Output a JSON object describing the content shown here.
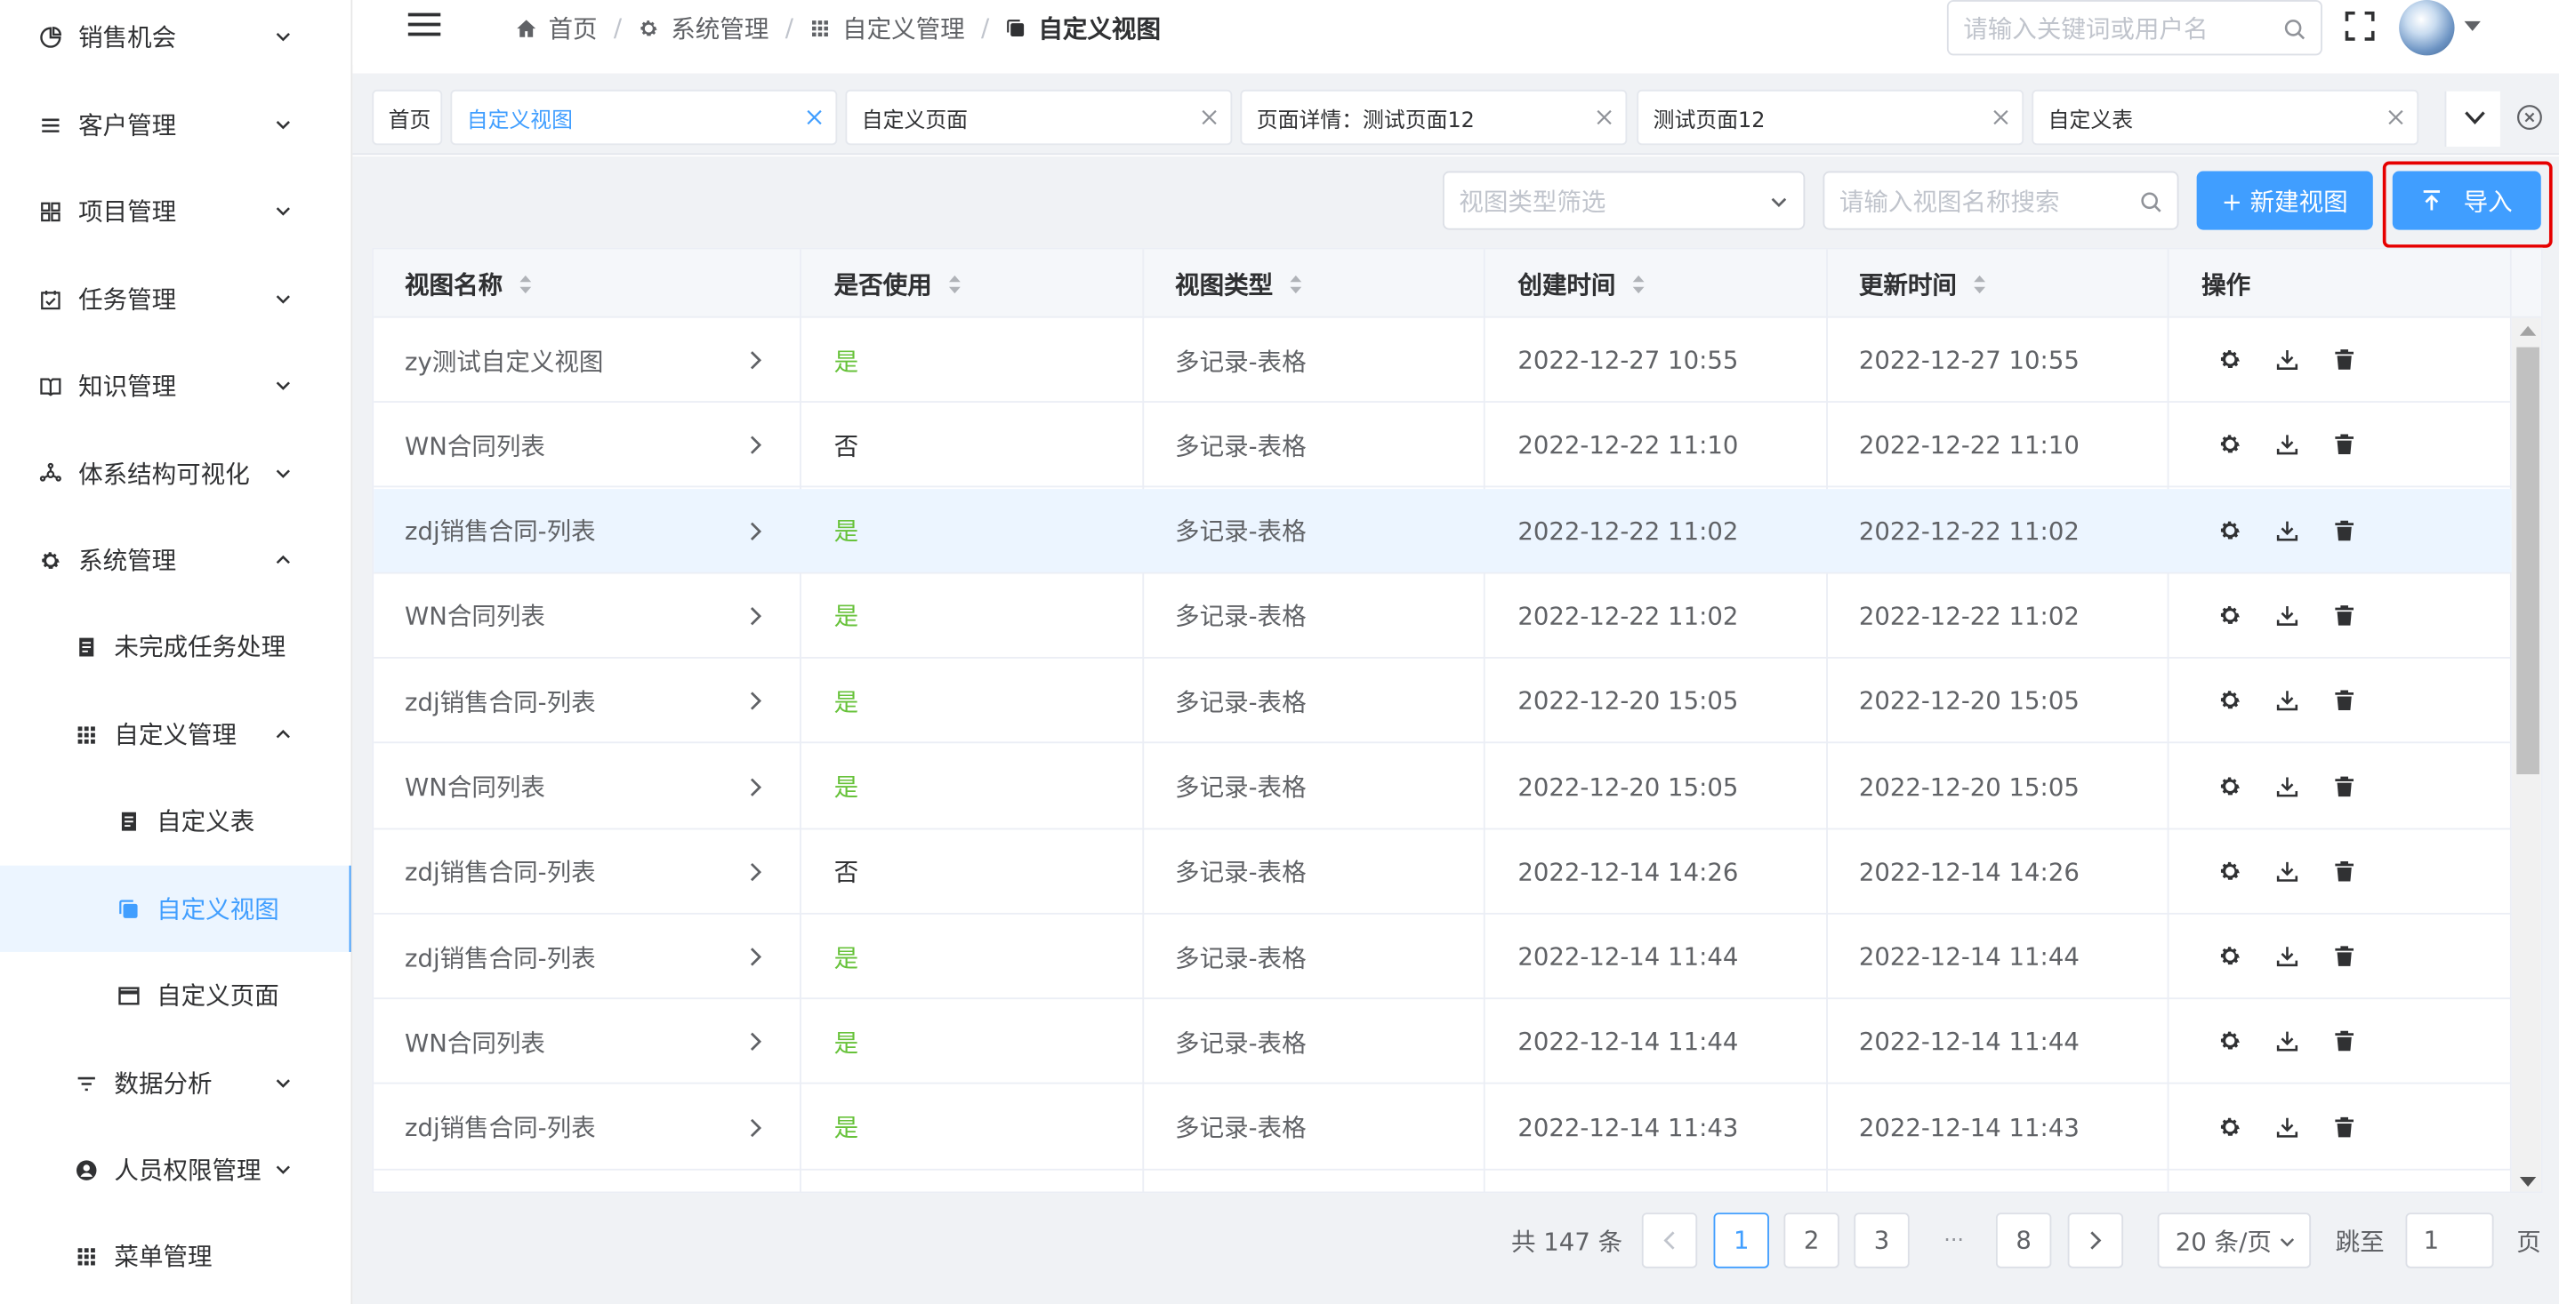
{
  "sidebar": {
    "items": [
      {
        "label": "销售机会",
        "icon": "pie-chart-icon",
        "arrow": "down"
      },
      {
        "label": "客户管理",
        "icon": "list-icon",
        "arrow": "down"
      },
      {
        "label": "项目管理",
        "icon": "grid-icon",
        "arrow": "down"
      },
      {
        "label": "任务管理",
        "icon": "calendar-check-icon",
        "arrow": "down"
      },
      {
        "label": "知识管理",
        "icon": "book-icon",
        "arrow": "down"
      },
      {
        "label": "体系结构可视化",
        "icon": "network-icon",
        "arrow": "down"
      },
      {
        "label": "系统管理",
        "icon": "gear-icon",
        "arrow": "up"
      },
      {
        "label": "未完成任务处理",
        "icon": "document-icon"
      },
      {
        "label": "自定义管理",
        "icon": "dots-grid-icon",
        "arrow": "up"
      },
      {
        "label": "自定义表",
        "icon": "document-icon"
      },
      {
        "label": "自定义视图",
        "icon": "copy-icon",
        "active": true
      },
      {
        "label": "自定义页面",
        "icon": "window-icon"
      },
      {
        "label": "数据分析",
        "icon": "filter-icon",
        "arrow": "down"
      },
      {
        "label": "人员权限管理",
        "icon": "user-icon",
        "arrow": "down"
      },
      {
        "label": "菜单管理",
        "icon": "dots-grid-icon"
      }
    ]
  },
  "header": {
    "breadcrumb": [
      {
        "label": "首页",
        "icon": "home-icon"
      },
      {
        "label": "系统管理",
        "icon": "gear-icon"
      },
      {
        "label": "自定义管理",
        "icon": "dots-grid-icon"
      },
      {
        "label": "自定义视图",
        "icon": "copy-icon"
      }
    ],
    "search_placeholder": "请输入关键词或用户名"
  },
  "tabs": [
    {
      "label": "首页",
      "closable": false
    },
    {
      "label": "自定义视图",
      "closable": true,
      "active": true
    },
    {
      "label": "自定义页面",
      "closable": true
    },
    {
      "label": "页面详情：测试页面12",
      "closable": true
    },
    {
      "label": "测试页面12",
      "closable": true
    },
    {
      "label": "自定义表",
      "closable": true
    }
  ],
  "toolbar": {
    "type_filter_placeholder": "视图类型筛选",
    "name_search_placeholder": "请输入视图名称搜索",
    "new_view_label": "+ 新建视图",
    "import_label": "导入"
  },
  "table": {
    "columns": [
      "视图名称",
      "是否使用",
      "视图类型",
      "创建时间",
      "更新时间",
      "操作"
    ],
    "rows": [
      {
        "name": "zy测试自定义视图",
        "used": "是",
        "type": "多记录-表格",
        "created": "2022-12-27 10:55",
        "updated": "2022-12-27 10:55"
      },
      {
        "name": "WN合同列表",
        "used": "否",
        "type": "多记录-表格",
        "created": "2022-12-22 11:10",
        "updated": "2022-12-22 11:10"
      },
      {
        "name": "zdj销售合同-列表",
        "used": "是",
        "type": "多记录-表格",
        "created": "2022-12-22 11:02",
        "updated": "2022-12-22 11:02"
      },
      {
        "name": "WN合同列表",
        "used": "是",
        "type": "多记录-表格",
        "created": "2022-12-22 11:02",
        "updated": "2022-12-22 11:02"
      },
      {
        "name": "zdj销售合同-列表",
        "used": "是",
        "type": "多记录-表格",
        "created": "2022-12-20 15:05",
        "updated": "2022-12-20 15:05"
      },
      {
        "name": "WN合同列表",
        "used": "是",
        "type": "多记录-表格",
        "created": "2022-12-20 15:05",
        "updated": "2022-12-20 15:05"
      },
      {
        "name": "zdj销售合同-列表",
        "used": "否",
        "type": "多记录-表格",
        "created": "2022-12-14 14:26",
        "updated": "2022-12-14 14:26"
      },
      {
        "name": "zdj销售合同-列表",
        "used": "是",
        "type": "多记录-表格",
        "created": "2022-12-14 11:44",
        "updated": "2022-12-14 11:44"
      },
      {
        "name": "WN合同列表",
        "used": "是",
        "type": "多记录-表格",
        "created": "2022-12-14 11:44",
        "updated": "2022-12-14 11:44"
      },
      {
        "name": "zdj销售合同-列表",
        "used": "是",
        "type": "多记录-表格",
        "created": "2022-12-14 11:43",
        "updated": "2022-12-14 11:43"
      }
    ],
    "action_icons": [
      "gear-icon",
      "download-icon",
      "trash-icon"
    ]
  },
  "pagination": {
    "total": "共 147 条",
    "pages": [
      "1",
      "2",
      "3",
      "8"
    ],
    "current": "1",
    "ellipsis": "···",
    "page_size": "20 条/页",
    "jump_prefix": "跳至",
    "jump_value": "1",
    "jump_suffix": "页"
  },
  "colors": {
    "accent": "#409eff",
    "success": "#67c23a",
    "highlight": "#e60000"
  }
}
